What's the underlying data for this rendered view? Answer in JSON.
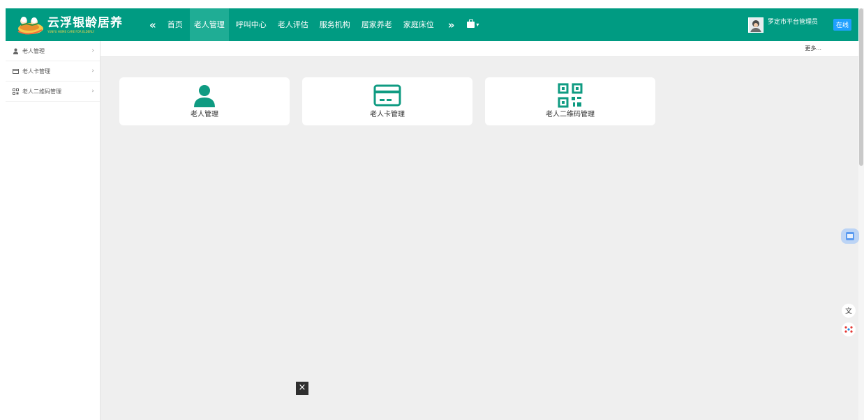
{
  "app": {
    "logo_title": "云浮银龄居养",
    "logo_subtitle": "YUNFU HOME CARE FOR ELDERLY"
  },
  "nav": {
    "collapse_icon": "double-chevron-left-icon",
    "items": [
      {
        "label": "首页",
        "active": false
      },
      {
        "label": "老人管理",
        "active": true
      },
      {
        "label": "呼叫中心",
        "active": false
      },
      {
        "label": "老人评估",
        "active": false
      },
      {
        "label": "服务机构",
        "active": false
      },
      {
        "label": "居家养老",
        "active": false
      },
      {
        "label": "家庭床位",
        "active": false
      }
    ],
    "expand_icon": "double-chevron-right-icon",
    "tools_icon": "suitcase-icon"
  },
  "user": {
    "name": "罗定市平台管理员",
    "status": "在线"
  },
  "sidebar": {
    "items": [
      {
        "label": "老人管理",
        "icon": "user-icon"
      },
      {
        "label": "老人卡管理",
        "icon": "card-icon"
      },
      {
        "label": "老人二维码管理",
        "icon": "qrcode-icon"
      }
    ]
  },
  "content": {
    "more_label": "更多...",
    "cards": [
      {
        "label": "老人管理",
        "icon": "user-icon"
      },
      {
        "label": "老人卡管理",
        "icon": "card-icon"
      },
      {
        "label": "老人二维码管理",
        "icon": "qrcode-icon"
      }
    ]
  },
  "overlay": {
    "close_label": "×"
  },
  "colors": {
    "brand": "#009b82",
    "brand_active": "#1fad95",
    "online_badge": "#1fa0ff",
    "background": "#efefef"
  }
}
